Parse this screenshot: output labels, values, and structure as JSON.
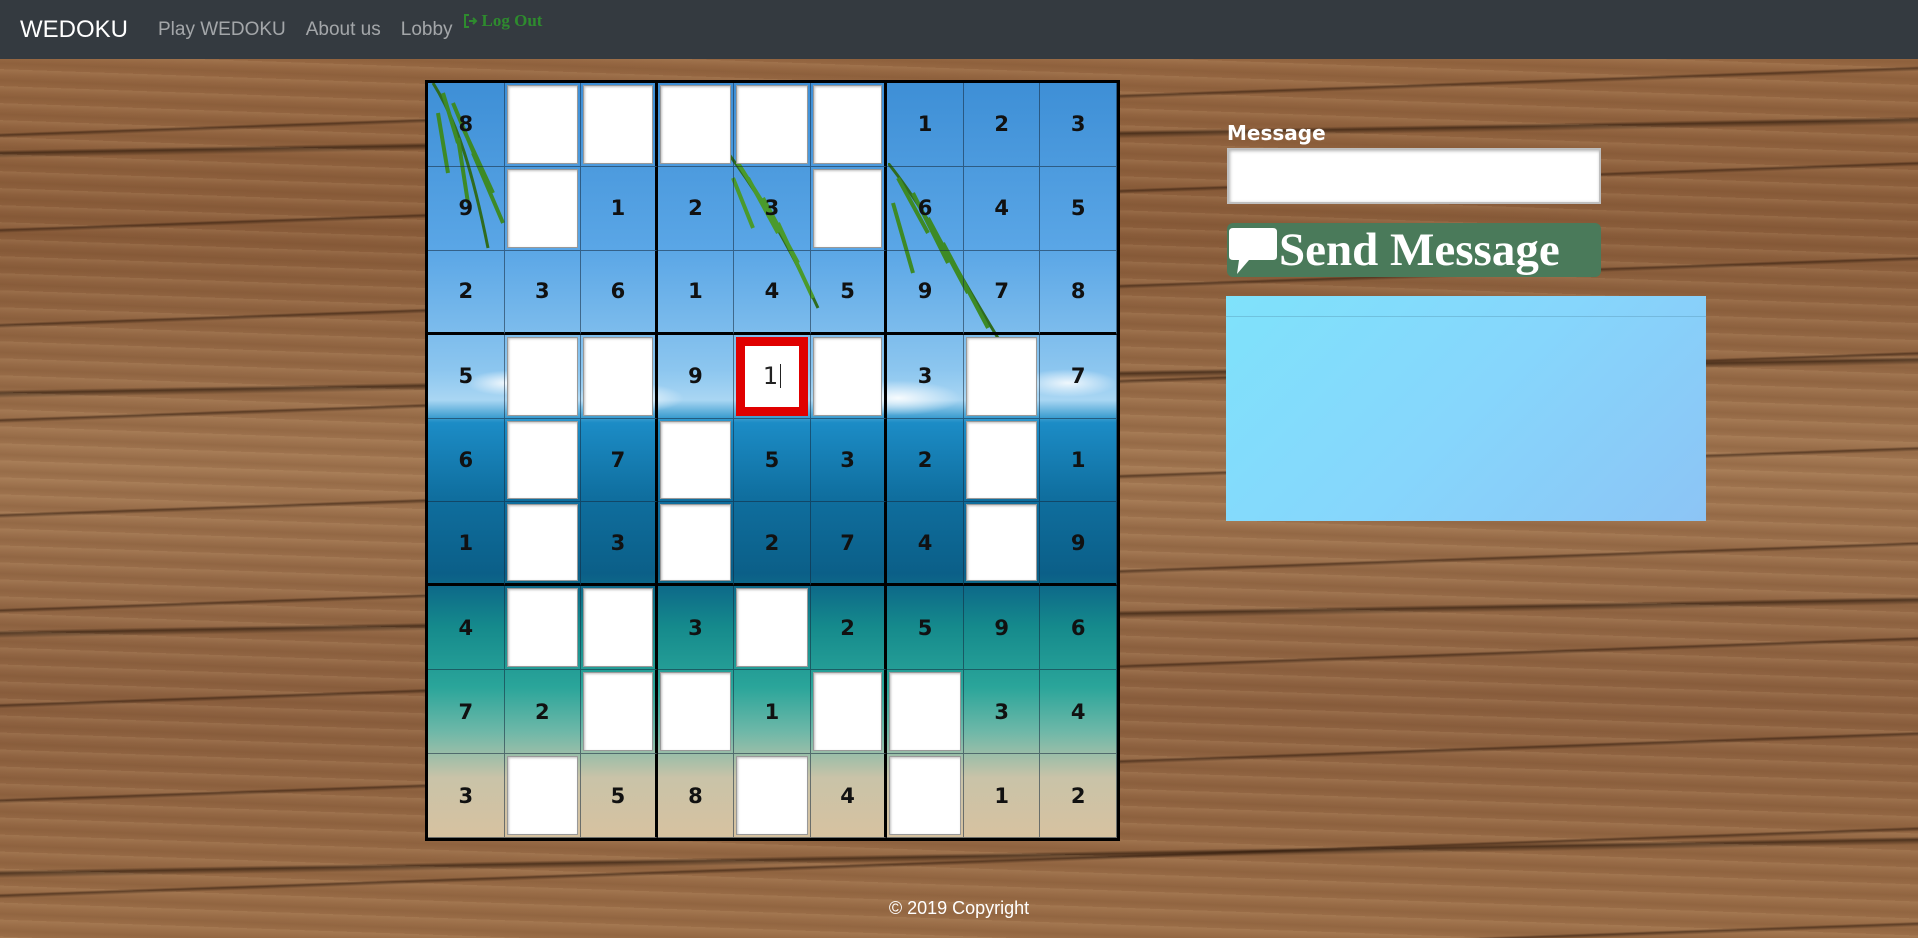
{
  "navbar": {
    "brand": "WEDOKU",
    "links": [
      "Play WEDOKU",
      "About us",
      "Lobby"
    ],
    "logout": "Log Out",
    "logout_icon": "sign-out-icon"
  },
  "board": {
    "rows": [
      [
        "8",
        "",
        "",
        "",
        "",
        "",
        "1",
        "2",
        "3"
      ],
      [
        "9",
        "",
        "1",
        "2",
        "3",
        "",
        "6",
        "4",
        "5"
      ],
      [
        "2",
        "3",
        "6",
        "1",
        "4",
        "5",
        "9",
        "7",
        "8"
      ],
      [
        "5",
        "",
        "",
        "9",
        "1",
        "",
        "3",
        "",
        "7"
      ],
      [
        "6",
        "",
        "7",
        "",
        "5",
        "3",
        "2",
        "",
        "1"
      ],
      [
        "1",
        "",
        "3",
        "",
        "2",
        "7",
        "4",
        "",
        "9"
      ],
      [
        "4",
        "",
        "",
        "3",
        "",
        "2",
        "5",
        "9",
        "6"
      ],
      [
        "7",
        "2",
        "",
        "",
        "1",
        "",
        "",
        "3",
        "4"
      ],
      [
        "3",
        "",
        "5",
        "8",
        "",
        "4",
        "",
        "1",
        "2"
      ]
    ],
    "active_cell": {
      "row": 3,
      "col": 4,
      "value": "1"
    },
    "highlight_color": "#e00000"
  },
  "chat": {
    "label": "Message",
    "input_value": "",
    "send_label": "Send Message",
    "send_icon": "speech-bubble-icon",
    "button_color": "#4a7a5a",
    "box_color": "#86d6fc"
  },
  "footer": {
    "text": "© 2019 Copyright"
  }
}
